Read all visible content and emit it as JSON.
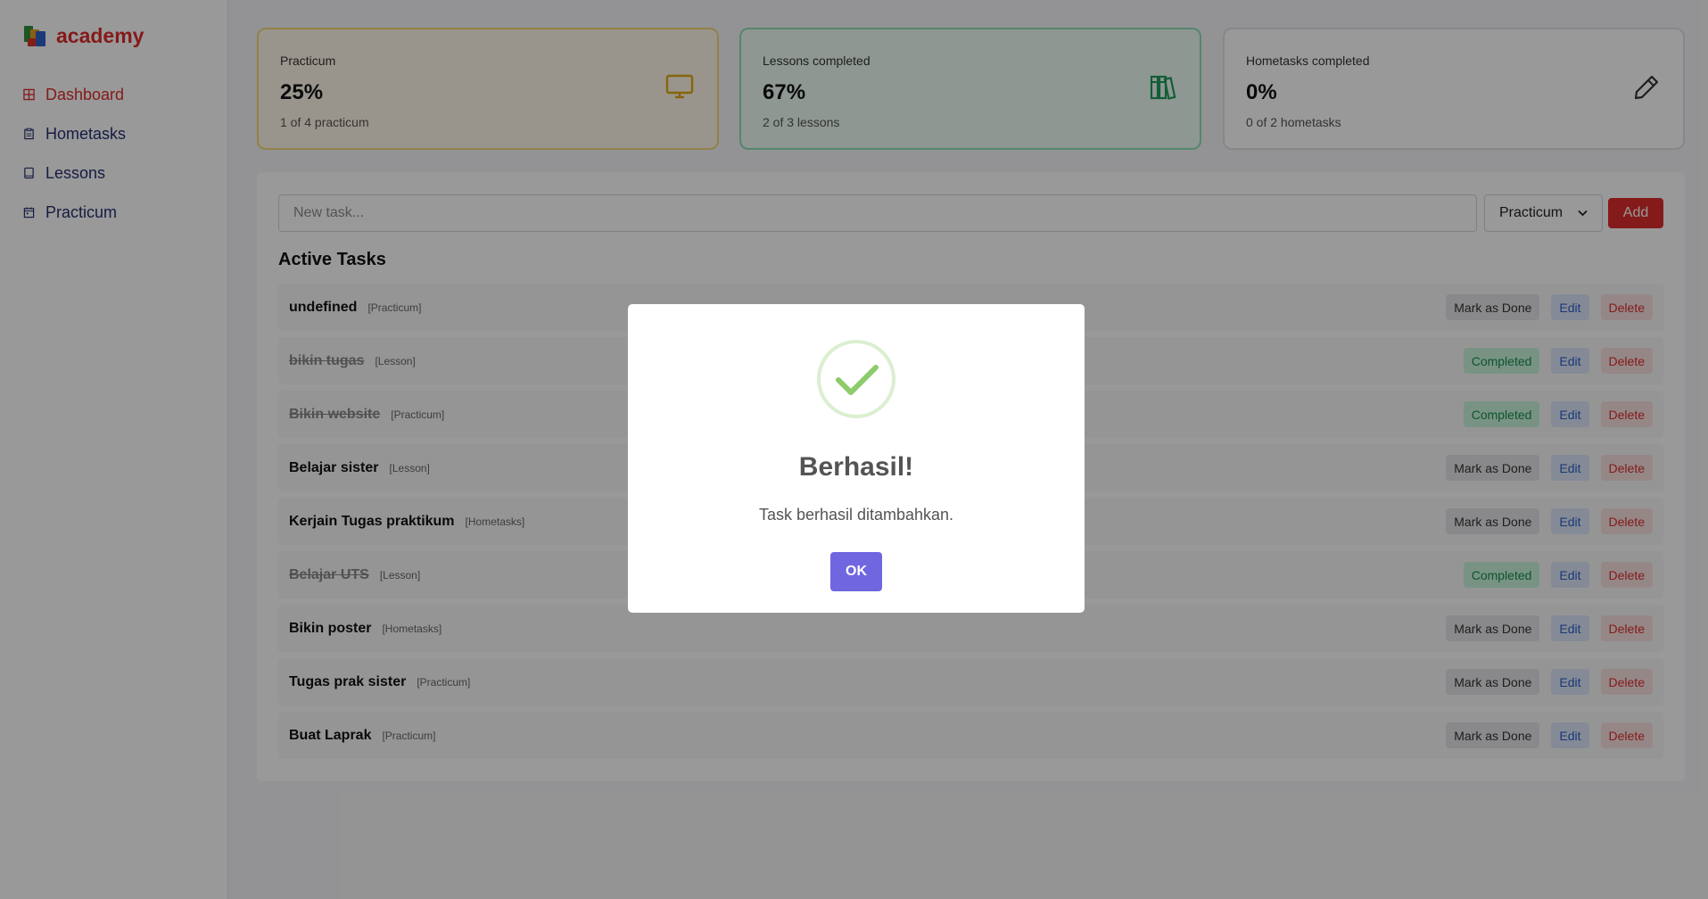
{
  "brand": {
    "name": "academy",
    "logo_icon": "books-logo-icon"
  },
  "sidebar": {
    "items": [
      {
        "label": "Dashboard",
        "icon": "grid-icon",
        "active": true
      },
      {
        "label": "Hometasks",
        "icon": "clipboard-icon",
        "active": false
      },
      {
        "label": "Lessons",
        "icon": "book-icon",
        "active": false
      },
      {
        "label": "Practicum",
        "icon": "calendar-icon",
        "active": false
      }
    ]
  },
  "stats": [
    {
      "label": "Practicum",
      "value": "25%",
      "sub": "1 of 4 practicum",
      "icon": "monitor-icon",
      "color": "#e0a813"
    },
    {
      "label": "Lessons completed",
      "value": "67%",
      "sub": "2 of 3 lessons",
      "icon": "books-icon",
      "color": "#1f9d5c"
    },
    {
      "label": "Hometasks completed",
      "value": "0%",
      "sub": "0 of 2 hometasks",
      "icon": "pencil-icon",
      "color": "#333333"
    }
  ],
  "composer": {
    "placeholder": "New task...",
    "category_selected": "Practicum",
    "add_label": "Add"
  },
  "active_tasks": {
    "title": "Active Tasks",
    "mark_label": "Mark as Done",
    "completed_label": "Completed",
    "edit_label": "Edit",
    "delete_label": "Delete",
    "items": [
      {
        "title": "undefined",
        "category": "[Practicum]",
        "done": false
      },
      {
        "title": "bikin tugas",
        "category": "[Lesson]",
        "done": true
      },
      {
        "title": "Bikin website",
        "category": "[Practicum]",
        "done": true
      },
      {
        "title": "Belajar sister",
        "category": "[Lesson]",
        "done": false
      },
      {
        "title": "Kerjain Tugas praktikum",
        "category": "[Hometasks]",
        "done": false
      },
      {
        "title": "Belajar UTS",
        "category": "[Lesson]",
        "done": true
      },
      {
        "title": "Bikin poster",
        "category": "[Hometasks]",
        "done": false
      },
      {
        "title": "Tugas prak sister",
        "category": "[Practicum]",
        "done": false
      },
      {
        "title": "Buat Laprak",
        "category": "[Practicum]",
        "done": false
      }
    ]
  },
  "modal": {
    "icon": "success-check-icon",
    "title": "Berhasil!",
    "text": "Task berhasil ditambahkan.",
    "ok_label": "OK"
  },
  "colors": {
    "accent": "#dc2c2c",
    "modal_button": "#7066e0",
    "success": "#8dcc6c"
  }
}
